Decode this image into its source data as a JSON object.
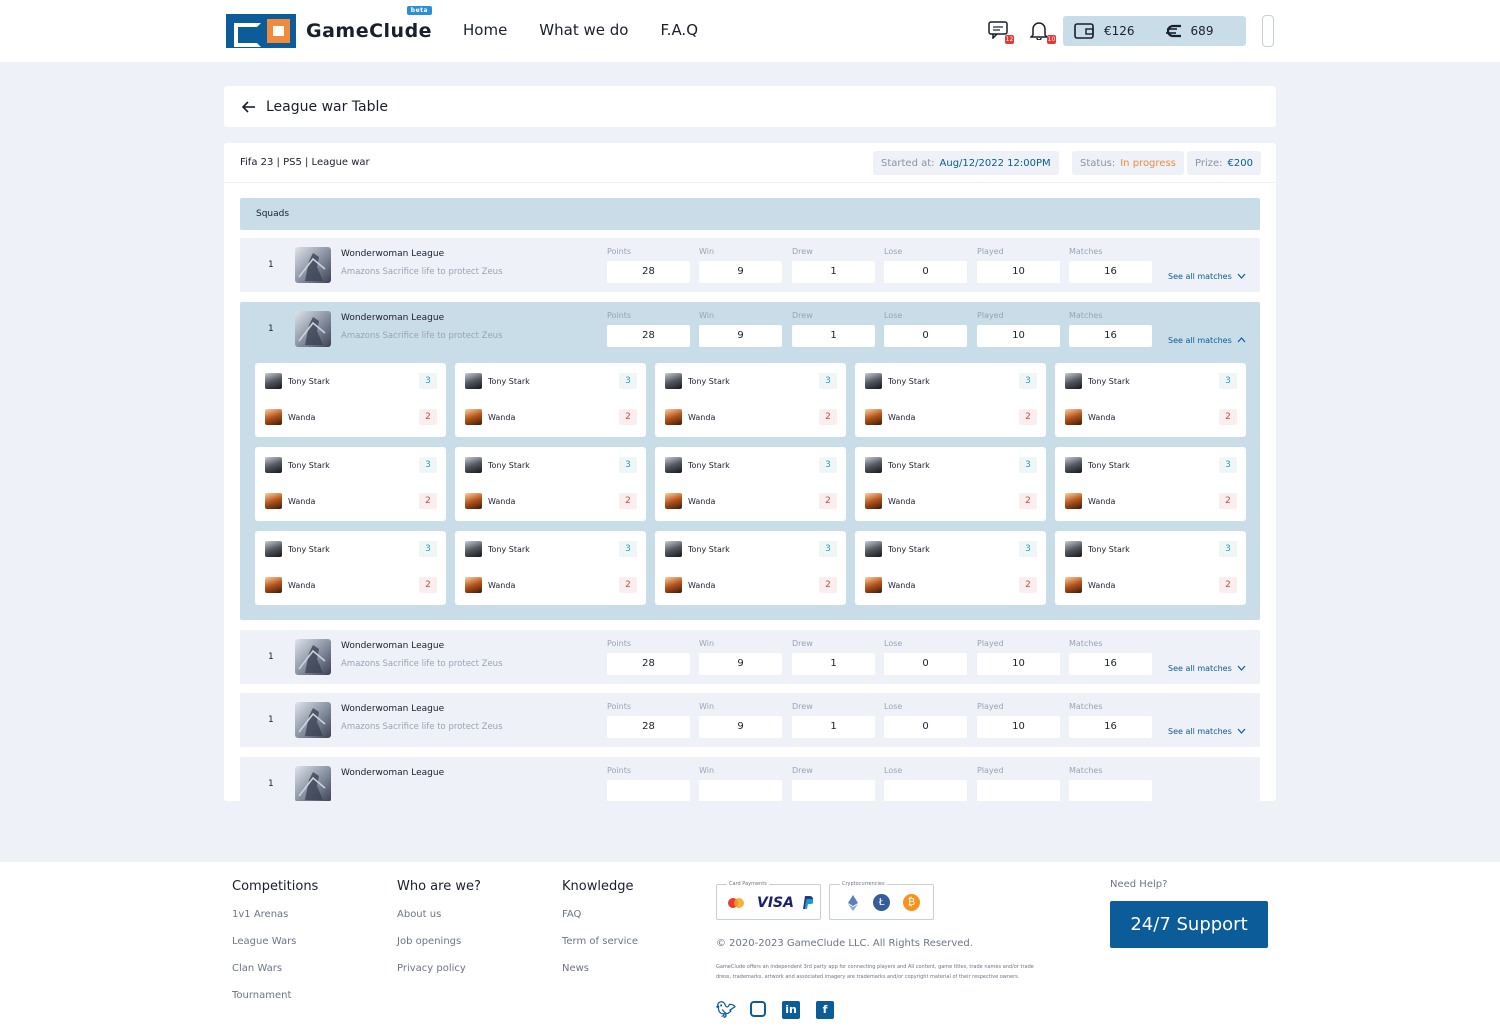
{
  "brand": {
    "name": "GameClude",
    "badge": "beta"
  },
  "nav": {
    "home": "Home",
    "what_we_do": "What we do",
    "faq": "F.A.Q"
  },
  "header": {
    "messages_badge": "12",
    "notifications_badge": "10",
    "wallet_amount": "€126",
    "coins_amount": "689"
  },
  "page": {
    "title": "League war Table"
  },
  "league": {
    "info": "Fifa 23 | PS5 | League war",
    "started_label": "Started at:",
    "started_value": "Aug/12/2022 12:00PM",
    "status_label": "Status:",
    "status_value": "In progress",
    "prize_label": "Prize:",
    "prize_value": "€200",
    "squads_label": "Squads"
  },
  "stat_labels": [
    "Points",
    "Win",
    "Drew",
    "Lose",
    "Played",
    "Matches"
  ],
  "rows": [
    {
      "rank": "1",
      "name": "Wonderwoman League",
      "desc": "Amazons Sacrifice life to protect Zeus",
      "stats": [
        "28",
        "9",
        "1",
        "0",
        "10",
        "16"
      ],
      "see_all": "See all matches"
    },
    {
      "rank": "1",
      "name": "Wonderwoman League",
      "desc": "Amazons Sacrifice life to protect Zeus",
      "stats": [
        "28",
        "9",
        "1",
        "0",
        "10",
        "16"
      ],
      "see_all": "See all matches"
    },
    {
      "rank": "1",
      "name": "Wonderwoman League",
      "desc": "Amazons Sacrifice life to protect Zeus",
      "stats": [
        "28",
        "9",
        "1",
        "0",
        "10",
        "16"
      ],
      "see_all": "See all matches"
    },
    {
      "rank": "1",
      "name": "Wonderwoman League",
      "desc": "Amazons Sacrifice life to protect Zeus",
      "stats": [
        "28",
        "9",
        "1",
        "0",
        "10",
        "16"
      ],
      "see_all": "See all matches"
    },
    {
      "rank": "1",
      "name": "Wonderwoman League",
      "desc": "",
      "stats": [
        "",
        "",
        "",
        "",
        "",
        ""
      ],
      "see_all": ""
    }
  ],
  "match": {
    "player1": "Tony Stark",
    "score1": "3",
    "player2": "Wanda",
    "score2": "2"
  },
  "footer": {
    "competitions": {
      "title": "Competitions",
      "links": [
        "1v1 Arenas",
        "League Wars",
        "Clan Wars",
        "Tournament"
      ]
    },
    "who": {
      "title": "Who are we?",
      "links": [
        "About us",
        "Job openings",
        "Privacy policy"
      ]
    },
    "knowledge": {
      "title": "Knowledge",
      "links": [
        "FAQ",
        "Term of service",
        "News"
      ]
    },
    "card_payments_label": "Card Payments",
    "crypto_label": "Cryptocurrencies",
    "copyright": "© 2020-2023 GameClude LLC. All Rights Reserved.",
    "fineprint": "GameClude offers an independent 3rd party app for connecting players and All content, game titles, trade names and/or trade dress, trademarks, artwork and associated imagery are trademarks and/or copyright material of their respective owners.",
    "help_label": "Need Help?",
    "support_button": "24/7 Support"
  },
  "colors": {
    "primary": "#0b5c99",
    "accent": "#f08a3c",
    "row_open": "#c8dde8",
    "win": "#2a9fb0",
    "lose": "#e0433f",
    "status": "#f08a3c"
  }
}
